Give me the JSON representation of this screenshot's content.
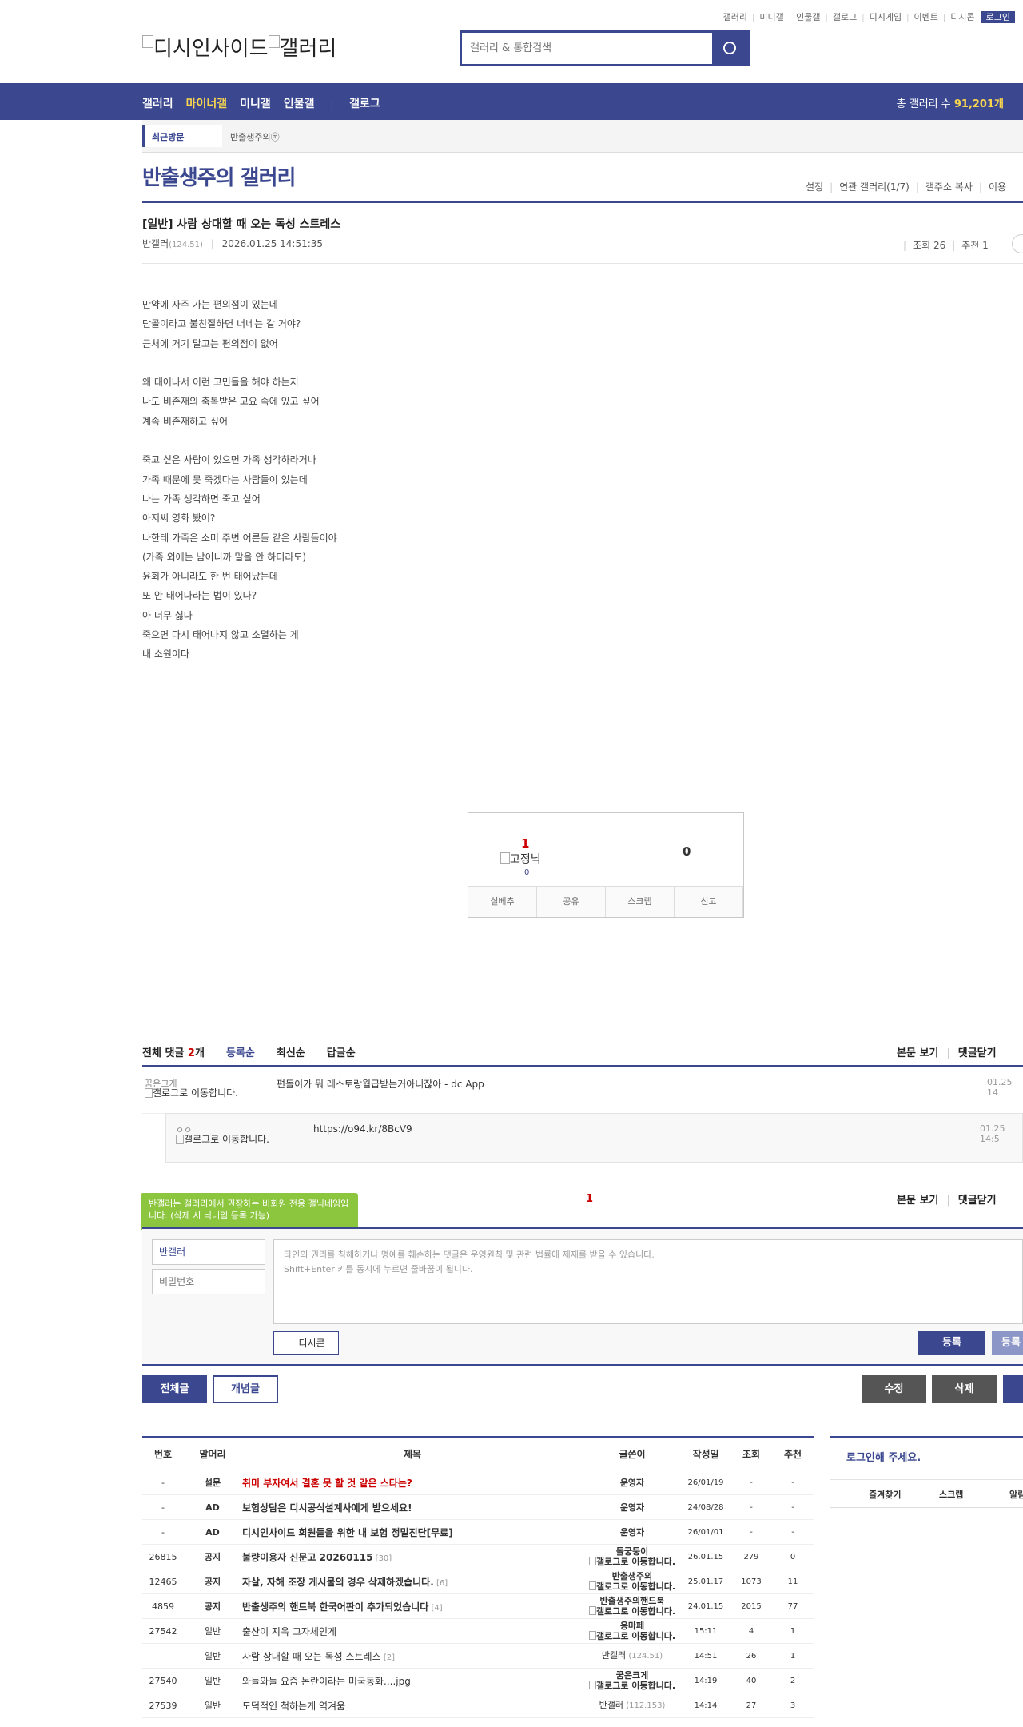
{
  "util_links": [
    "갤러리",
    "미니갤",
    "인물갤",
    "갤로그",
    "디시게임",
    "이벤트",
    "디시콘"
  ],
  "login_label": "로그인",
  "logo_alt": "디시인사이드",
  "logo_gallery_alt": "갤러리",
  "search_placeholder": "갤러리 & 통합검색",
  "nav": {
    "items": [
      "갤러리",
      "마이너갤",
      "미니갤",
      "인물갤",
      "갤로그"
    ],
    "active": "마이너갤",
    "total_label": "총 갤러리 수",
    "total_value": "91,201개"
  },
  "recent": {
    "label": "최근방문",
    "item": "반출생주의ⓜ"
  },
  "gallery": {
    "title": "반출생주의 갤러리",
    "links": [
      "설정",
      "연관 갤러리(1/7)",
      "갤주소 복사",
      "이용"
    ]
  },
  "post": {
    "title": "[일반] 사람 상대할 때 오는 독성 스트레스",
    "author": "반갤러",
    "ip": "(124.51)",
    "datetime": "2026.01.25 14:51:35",
    "views_label": "조회 26",
    "recommend_label": "추천 1",
    "body": [
      "만약에 자주 가는 편의점이 있는데",
      "단골이라고 불친절하면 너네는 갈 거야?",
      "근처에 거기 말고는 편의점이 없어",
      "",
      "왜 태어나서 이런 고민들을 해야 하는지",
      "나도 비존재의 축복받은 고요 속에 있고 싶어",
      "계속 비존재하고 싶어",
      "",
      "죽고 싶은 사람이 있으면 가족 생각하라거나",
      "가족 때문에 못 죽겠다는 사람들이 있는데",
      "나는 가족 생각하면 죽고 싶어",
      "아저씨 영화 봤어?",
      "나한테 가족은 소미 주변 어른들 같은 사람들이야",
      "(가족 외에는 남이니까 말을 안 하더라도)",
      "윤회가 아니라도 한 번 태어났는데",
      "또 안 태어나라는 법이 있나?",
      "아 너무 싫다",
      "죽으면 다시 태어나지 않고 소멸하는 게",
      "내 소원이다"
    ]
  },
  "recommend": {
    "up_count": "1",
    "fixed_alt": "고정닉",
    "fixed_count": "0",
    "down_count": "0",
    "buttons": [
      "실베추",
      "공유",
      "스크랩",
      "신고"
    ]
  },
  "comments": {
    "total_prefix": "전체 댓글",
    "total_count": "2",
    "total_suffix": "개",
    "sorts": [
      "등록순",
      "최신순",
      "답글순"
    ],
    "right_links": [
      "본문 보기",
      "댓글닫기"
    ],
    "items": [
      {
        "nick": "꿈은크게",
        "img_alt": "갤로그로 이동합니다.",
        "text": "편돌이가 뭐 레스토랑월급받는거아니잖아 - dc App",
        "time": "01.25 14"
      },
      {
        "nick": "ㅇㅇ",
        "img_alt": "갤로그로 이동합니다.",
        "text": "https://o94.kr/8BcV9",
        "time": "01.25 14:5"
      }
    ],
    "page": "1"
  },
  "write": {
    "tooltip": "반갤러는 갤러리에서 권장하는 비회원 전용 갤닉네임입니다. (삭제 시 닉네임 등록 가능)",
    "nick_value": "반갤러",
    "pw_placeholder": "비밀번호",
    "notice1": "타인의 권리를 침해하거나 명예를 훼손하는 댓글은 운영원칙 및 관련 법률에 제재를 받을 수 있습니다.",
    "notice2": "Shift+Enter 키를 동시에 누르면 줄바꿈이 됩니다.",
    "dccon_label": "디시콘",
    "submit_label": "등록",
    "submit2_label": "등록"
  },
  "actions": {
    "all_label": "전체글",
    "concept_label": "개념글",
    "edit_label": "수정",
    "delete_label": "삭제"
  },
  "list": {
    "headers": [
      "번호",
      "말머리",
      "제목",
      "글쓴이",
      "작성일",
      "조회",
      "추천"
    ],
    "rows": [
      {
        "num": "-",
        "head": "설문",
        "title": "취미 부자여서 결혼 못 할 것 같은 스타는?",
        "reply": "",
        "writer": "운영자",
        "writer_ip": "",
        "gallog": "",
        "date": "26/01/19",
        "views": "-",
        "rec": "-",
        "style": "survey"
      },
      {
        "num": "-",
        "head": "AD",
        "title": "보험상담은 디시공식설계사에게 받으세요!",
        "reply": "",
        "writer": "운영자",
        "writer_ip": "",
        "gallog": "",
        "date": "24/08/28",
        "views": "-",
        "rec": "-",
        "style": "notice"
      },
      {
        "num": "-",
        "head": "AD",
        "title": "디시인사이드 회원들을 위한 내 보험 정밀진단[무료]",
        "reply": "",
        "writer": "운영자",
        "writer_ip": "",
        "gallog": "",
        "date": "26/01/01",
        "views": "-",
        "rec": "-",
        "style": "notice"
      },
      {
        "num": "26815",
        "head": "공지",
        "title": "불량이용자 신문고 20260115",
        "reply": "[30]",
        "writer": "돌궁둥이",
        "writer_ip": "",
        "gallog": "갤로그로 이동합니다.",
        "date": "26.01.15",
        "views": "279",
        "rec": "0",
        "style": "notice"
      },
      {
        "num": "12465",
        "head": "공지",
        "title": "자살, 자해 조장 게시물의 경우 삭제하겠습니다.",
        "reply": "[6]",
        "writer": "반출생주의",
        "writer_ip": "",
        "gallog": "갤로그로 이동합니다.",
        "date": "25.01.17",
        "views": "1073",
        "rec": "11",
        "style": "notice"
      },
      {
        "num": "4859",
        "head": "공지",
        "title": "반출생주의 핸드북 한국어판이 추가되었습니다",
        "reply": "[4]",
        "writer": "반출생주의핸드북",
        "writer_ip": "",
        "gallog": "갤로그로 이동합니다.",
        "date": "24.01.15",
        "views": "2015",
        "rec": "77",
        "style": "notice"
      },
      {
        "num": "27542",
        "head": "일반",
        "title": "출산이 지옥 그자체인게",
        "reply": "",
        "writer": "응마페",
        "writer_ip": "",
        "gallog": "갤로그로 이동합니다.",
        "date": "15:11",
        "views": "4",
        "rec": "1",
        "style": "normal"
      },
      {
        "num": "",
        "head": "일반",
        "title": "사람 상대할 때 오는 독성 스트레스",
        "reply": "[2]",
        "writer": "반갤러",
        "writer_ip": "(124.51)",
        "gallog": "",
        "date": "14:51",
        "views": "26",
        "rec": "1",
        "style": "normal"
      },
      {
        "num": "27540",
        "head": "일반",
        "title": "와들와들 요즘 논란이라는 미국동화....jpg",
        "reply": "",
        "writer": "꿈은크게",
        "writer_ip": "",
        "gallog": "갤로그로 이동합니다.",
        "date": "14:19",
        "views": "40",
        "rec": "2",
        "style": "normal"
      },
      {
        "num": "27539",
        "head": "일반",
        "title": "도덕적인 척하는게 역겨움",
        "reply": "",
        "writer": "반갤러",
        "writer_ip": "(112.153)",
        "gallog": "",
        "date": "14:14",
        "views": "27",
        "rec": "3",
        "style": "normal"
      }
    ]
  },
  "side": {
    "login_prompt": "로그인해 주세요.",
    "links": [
      "즐겨찾기",
      "스크랩",
      "알림"
    ]
  }
}
